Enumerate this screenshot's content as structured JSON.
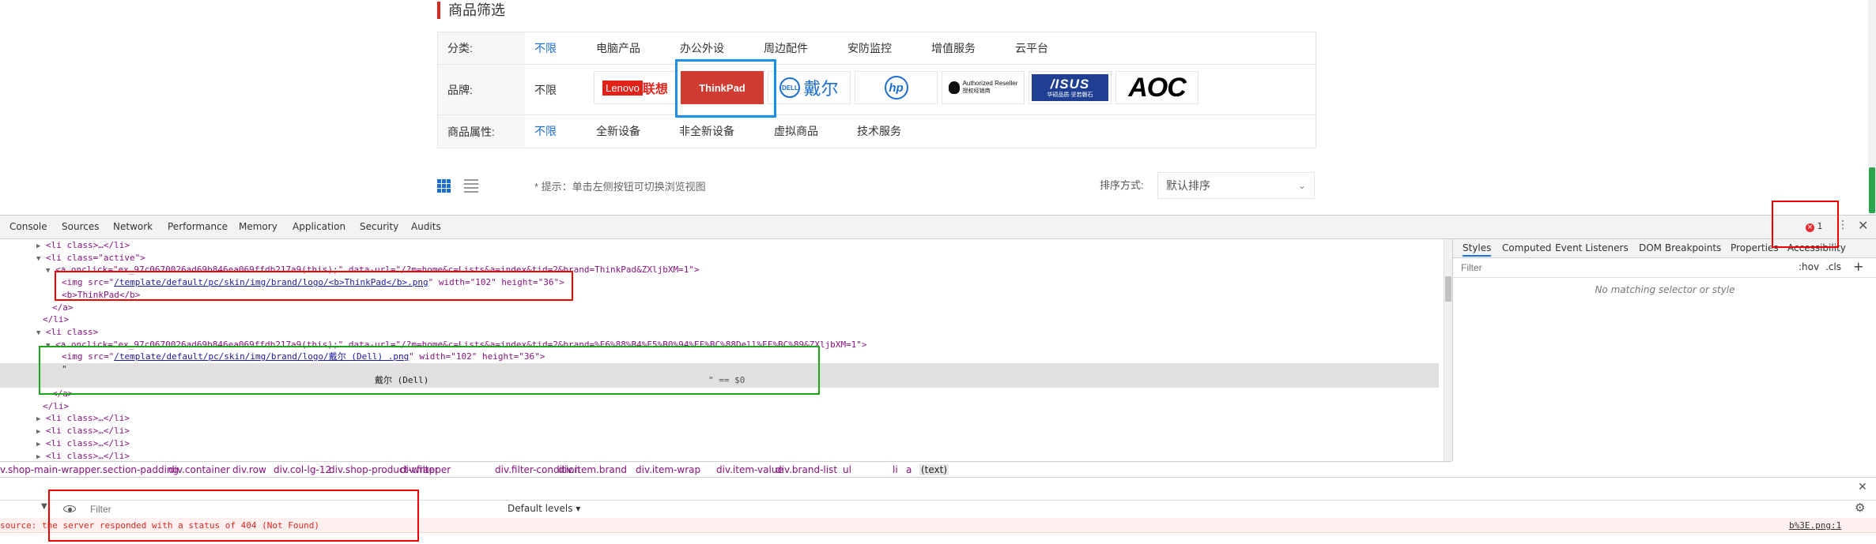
{
  "page": {
    "section_title": "商品筛选",
    "filters": [
      {
        "label": "分类:",
        "options": [
          "不限",
          "电脑产品",
          "办公外设",
          "周边配件",
          "安防监控",
          "增值服务",
          "云平台"
        ],
        "active_index": 0
      },
      {
        "label": "品牌:",
        "first_option": "不限",
        "brands": [
          "Lenovo联想",
          "ThinkPad",
          "DELL戴尔",
          "hp",
          "Authorized Reseller 授权经销商",
          "ASUS 华硕品质·坚若磐石",
          "AOC"
        ],
        "selected_brand": "ThinkPad"
      },
      {
        "label": "商品属性:",
        "options": [
          "不限",
          "全新设备",
          "非全新设备",
          "虚拟商品",
          "技术服务"
        ],
        "active_index": 0
      }
    ],
    "view_hint": "* 提示：单击左侧按钮可切换浏览视图",
    "sort_label": "排序方式:",
    "sort_value": "默认排序",
    "lenovo_text": "Lenovo",
    "lenovo_cn": "联想",
    "thinkpad_text": "ThinkPad",
    "dell_logo": "DELL",
    "dell_cn": "戴尔",
    "hp_text": "hp",
    "apple_line1": "Authorized Reseller",
    "apple_line2": "授权经销商",
    "asus_text": "/ISUS",
    "asus_sub": "华硕品质·坚若磐石",
    "aoc_text": "AOC"
  },
  "devtools": {
    "tabs": [
      "Console",
      "Sources",
      "Network",
      "Performance",
      "Memory",
      "Application",
      "Security",
      "Audits"
    ],
    "error_count": "1",
    "code": {
      "l1": "<li class>…</li>",
      "l2_tag": "<li class=\"active\">",
      "l3": "<a onclick=\"ex_97c0670026ad69b846ea069ffdb217a9(this);\" data-url=\"/?m=home&c=Lists&a=index&tid=2&brand=ThinkPad&ZXljbXM=1\">",
      "l4_pre": "<img src=\"",
      "l4_link": "/template/default/pc/skin/img/brand/logo/<b>ThinkPad</b>.png",
      "l4_post": "\" width=\"102\" height=\"36\">",
      "l5": "<b>ThinkPad</b>",
      "l6": "</a>",
      "l7": "</li>",
      "l8": "<li class>",
      "l9": "<a onclick=\"ex_97c0670026ad69b846ea069ffdb217a9(this);\" data-url=\"/?m=home&c=Lists&a=index&tid=2&brand=%E6%88%B4%E5%B0%94%EF%BC%88Dell%EF%BC%89&ZXljbXM=1\">",
      "l10_pre": "<img src=\"",
      "l10_link": "/template/default/pc/skin/img/brand/logo/戴尔 (Dell) .png",
      "l10_post": "\" width=\"102\" height=\"36\">",
      "l11": "\"",
      "l12_text": "戴尔 (Dell)",
      "l12_tail": "\" == $0",
      "l13": "</a>",
      "l14": "</li>",
      "l15": "<li class>…</li>",
      "l16": "<li class>…</li>",
      "l17": "<li class>…</li>",
      "l18": "<li class>…</li>"
    },
    "styles_tabs": [
      "Styles",
      "Computed",
      "Event Listeners",
      "DOM Breakpoints",
      "Properties",
      "Accessibility"
    ],
    "filter_placeholder": "Filter",
    "hov": ":hov",
    "cls": ".cls",
    "no_match": "No matching selector or style",
    "breadcrumbs": [
      "v.shop-main-wrapper.section-padding",
      "div.container",
      "div.row",
      "div.col-lg-12",
      "div.shop-product-wrapper",
      "div.filter",
      "div.filter-condition",
      "div.item.brand",
      "div.item-wrap",
      "div.item-value",
      "div.brand-list",
      "ul",
      "li",
      "a",
      "(text)"
    ],
    "console_filter_placeholder": "Filter",
    "default_levels": "Default levels ▾",
    "error_message": "source: the server responded with a status of 404 (Not Found)",
    "error_link": "b%3E.png:1"
  }
}
